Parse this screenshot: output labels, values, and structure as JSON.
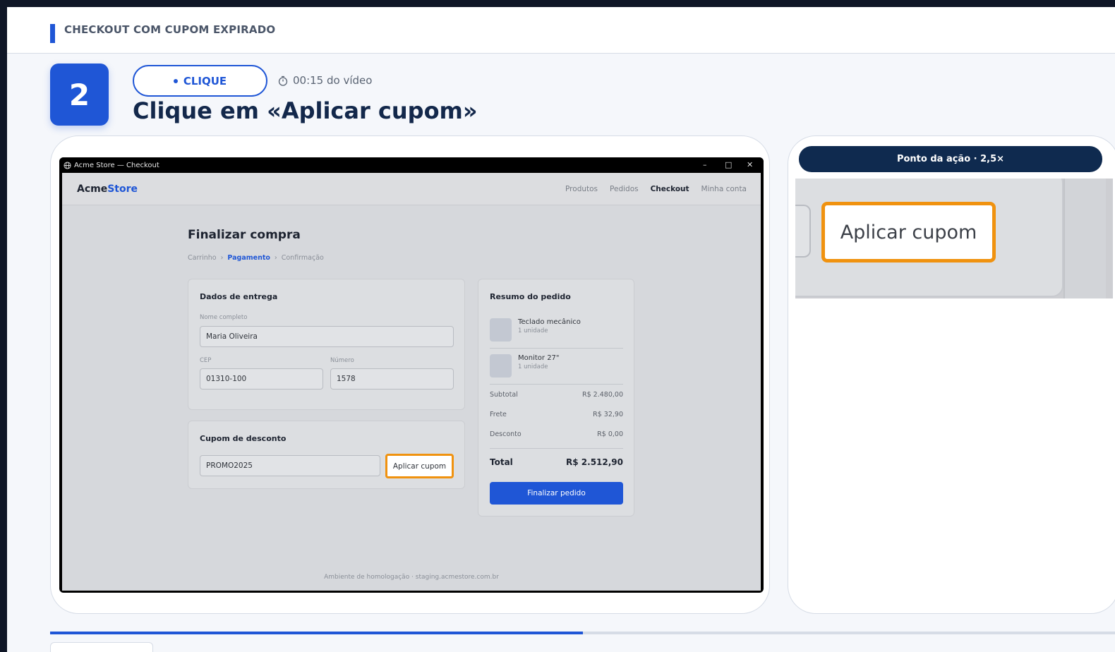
{
  "header": {
    "title": "CHECKOUT COM CUPOM EXPIRADO"
  },
  "step": {
    "number": "2",
    "action": "CLIQUE",
    "timestamp": "00:15 do vídeo",
    "title": "Clique em «Aplicar cupom»"
  },
  "window": {
    "title": "Acme Store — Checkout"
  },
  "app": {
    "brand_a": "Acme",
    "brand_b": "Store",
    "nav": [
      "Produtos",
      "Pedidos",
      "Checkout",
      "Minha conta"
    ],
    "heading": "Finalizar compra",
    "breadcrumb": [
      "Carrinho",
      "Pagamento",
      "Confirmação"
    ],
    "delivery": {
      "title": "Dados de entrega",
      "name_label": "Nome completo",
      "name_value": "Maria Oliveira",
      "cep_label": "CEP",
      "cep_value": "01310-100",
      "number_label": "Número",
      "number_value": "1578"
    },
    "coupon": {
      "title": "Cupom de desconto",
      "code": "PROMO2025",
      "apply": "Aplicar cupom"
    },
    "summary": {
      "title": "Resumo do pedido",
      "items": [
        {
          "name": "Teclado mecânico",
          "qty": "1 unidade"
        },
        {
          "name": "Monitor 27\"",
          "qty": "1 unidade"
        }
      ],
      "subtotal_label": "Subtotal",
      "subtotal": "R$ 2.480,00",
      "shipping_label": "Frete",
      "shipping": "R$ 32,90",
      "discount_label": "Desconto",
      "discount": "R$ 0,00",
      "total_label": "Total",
      "total": "R$ 2.512,90",
      "finish": "Finalizar pedido"
    },
    "footer": "Ambiente de homologação · staging.acmestore.com.br"
  },
  "zoom": {
    "label": "Ponto da ação · 2,5×",
    "button": "Aplicar cupom"
  },
  "progress": {
    "fraction": 0.5
  },
  "colors": {
    "accent": "#1f56d6",
    "highlight": "#f0920f",
    "navy": "#0f2a4f"
  }
}
